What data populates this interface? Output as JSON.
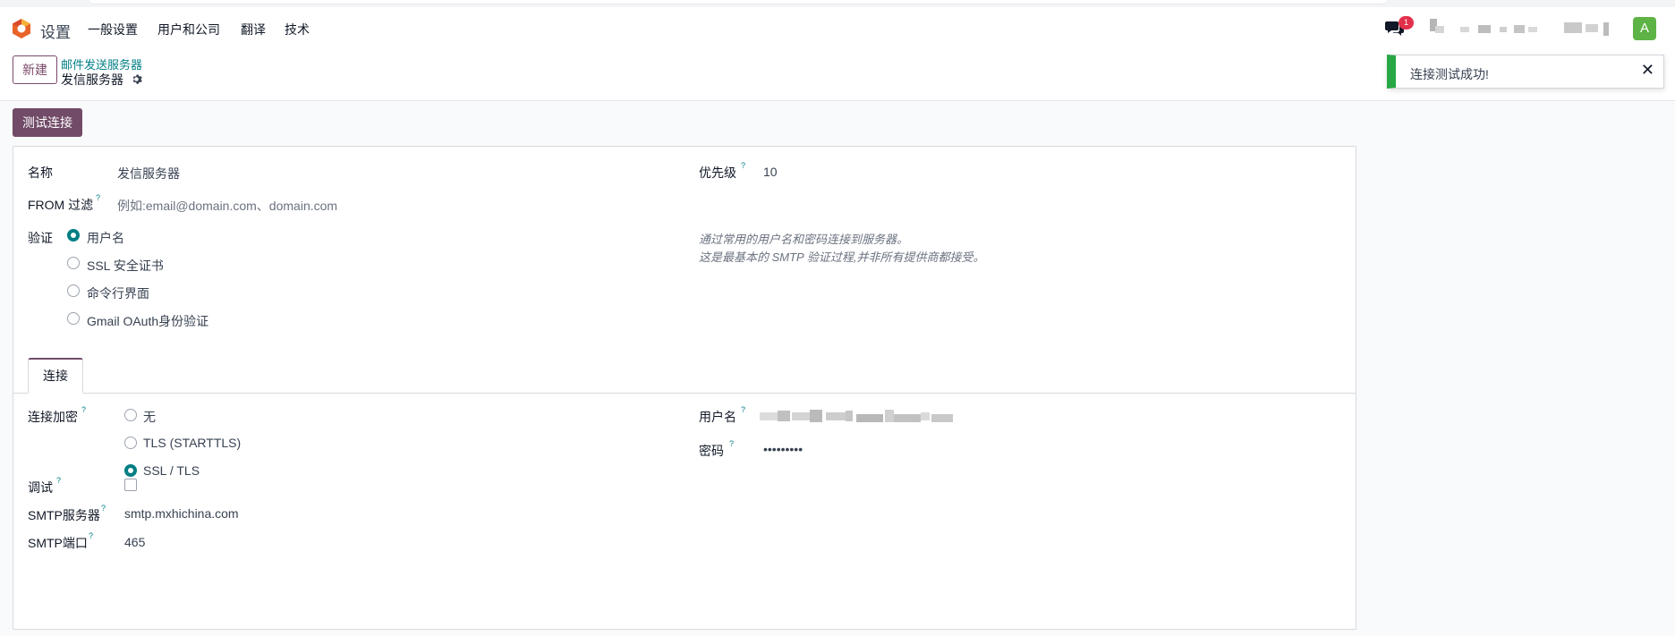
{
  "navbar": {
    "app_title": "设置",
    "menu": [
      "一般设置",
      "用户和公司",
      "翻译",
      "技术"
    ],
    "chat_badge": "1",
    "avatar_letter": "A"
  },
  "control": {
    "new_label": "新建",
    "breadcrumb_parent": "邮件发送服务器",
    "breadcrumb_current": "发信服务器"
  },
  "toast": {
    "message": "连接测试成功!",
    "close": "✕"
  },
  "actions": {
    "test_connection": "测试连接"
  },
  "form": {
    "name_label": "名称",
    "name_value": "发信服务器",
    "from_filter_label": "FROM 过滤",
    "from_filter_placeholder": "例如:email@domain.com、domain.com",
    "priority_label": "优先级",
    "priority_value": "10",
    "auth_label": "验证",
    "auth_options": [
      "用户名",
      "SSL 安全证书",
      "命令行界面",
      "Gmail OAuth身份验证"
    ],
    "auth_selected": 0,
    "auth_note_1": "通过常用的用户名和密码连接到服务器。",
    "auth_note_2": "这是最基本的 SMTP 验证过程,并非所有提供商都接受。",
    "tab_label": "连接",
    "encryption_label": "连接加密",
    "encryption_options": [
      "无",
      "TLS (STARTTLS)",
      "SSL / TLS"
    ],
    "encryption_selected": 2,
    "username_label": "用户名",
    "password_label": "密码",
    "password_value": "•••••••••",
    "debug_label": "调试",
    "smtp_server_label": "SMTP服务器",
    "smtp_server_value": "smtp.mxhichina.com",
    "smtp_port_label": "SMTP端口",
    "smtp_port_value": "465",
    "help_mark": "?"
  },
  "colors": {
    "brand": "#714b67",
    "link": "#017e84",
    "success": "#28a745",
    "avatar": "#5db345",
    "badge": "#e1304b"
  }
}
